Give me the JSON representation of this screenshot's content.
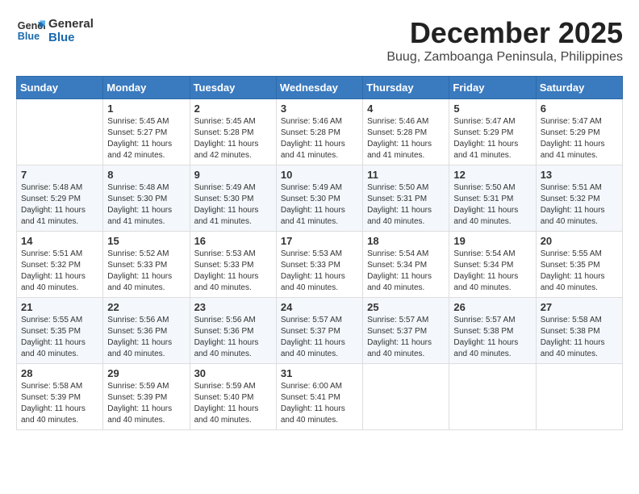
{
  "logo": {
    "line1": "General",
    "line2": "Blue"
  },
  "title": "December 2025",
  "location": "Buug, Zamboanga Peninsula, Philippines",
  "headers": [
    "Sunday",
    "Monday",
    "Tuesday",
    "Wednesday",
    "Thursday",
    "Friday",
    "Saturday"
  ],
  "weeks": [
    [
      {
        "day": "",
        "info": ""
      },
      {
        "day": "1",
        "info": "Sunrise: 5:45 AM\nSunset: 5:27 PM\nDaylight: 11 hours\nand 42 minutes."
      },
      {
        "day": "2",
        "info": "Sunrise: 5:45 AM\nSunset: 5:28 PM\nDaylight: 11 hours\nand 42 minutes."
      },
      {
        "day": "3",
        "info": "Sunrise: 5:46 AM\nSunset: 5:28 PM\nDaylight: 11 hours\nand 41 minutes."
      },
      {
        "day": "4",
        "info": "Sunrise: 5:46 AM\nSunset: 5:28 PM\nDaylight: 11 hours\nand 41 minutes."
      },
      {
        "day": "5",
        "info": "Sunrise: 5:47 AM\nSunset: 5:29 PM\nDaylight: 11 hours\nand 41 minutes."
      },
      {
        "day": "6",
        "info": "Sunrise: 5:47 AM\nSunset: 5:29 PM\nDaylight: 11 hours\nand 41 minutes."
      }
    ],
    [
      {
        "day": "7",
        "info": "Sunrise: 5:48 AM\nSunset: 5:29 PM\nDaylight: 11 hours\nand 41 minutes."
      },
      {
        "day": "8",
        "info": "Sunrise: 5:48 AM\nSunset: 5:30 PM\nDaylight: 11 hours\nand 41 minutes."
      },
      {
        "day": "9",
        "info": "Sunrise: 5:49 AM\nSunset: 5:30 PM\nDaylight: 11 hours\nand 41 minutes."
      },
      {
        "day": "10",
        "info": "Sunrise: 5:49 AM\nSunset: 5:30 PM\nDaylight: 11 hours\nand 41 minutes."
      },
      {
        "day": "11",
        "info": "Sunrise: 5:50 AM\nSunset: 5:31 PM\nDaylight: 11 hours\nand 40 minutes."
      },
      {
        "day": "12",
        "info": "Sunrise: 5:50 AM\nSunset: 5:31 PM\nDaylight: 11 hours\nand 40 minutes."
      },
      {
        "day": "13",
        "info": "Sunrise: 5:51 AM\nSunset: 5:32 PM\nDaylight: 11 hours\nand 40 minutes."
      }
    ],
    [
      {
        "day": "14",
        "info": "Sunrise: 5:51 AM\nSunset: 5:32 PM\nDaylight: 11 hours\nand 40 minutes."
      },
      {
        "day": "15",
        "info": "Sunrise: 5:52 AM\nSunset: 5:33 PM\nDaylight: 11 hours\nand 40 minutes."
      },
      {
        "day": "16",
        "info": "Sunrise: 5:53 AM\nSunset: 5:33 PM\nDaylight: 11 hours\nand 40 minutes."
      },
      {
        "day": "17",
        "info": "Sunrise: 5:53 AM\nSunset: 5:33 PM\nDaylight: 11 hours\nand 40 minutes."
      },
      {
        "day": "18",
        "info": "Sunrise: 5:54 AM\nSunset: 5:34 PM\nDaylight: 11 hours\nand 40 minutes."
      },
      {
        "day": "19",
        "info": "Sunrise: 5:54 AM\nSunset: 5:34 PM\nDaylight: 11 hours\nand 40 minutes."
      },
      {
        "day": "20",
        "info": "Sunrise: 5:55 AM\nSunset: 5:35 PM\nDaylight: 11 hours\nand 40 minutes."
      }
    ],
    [
      {
        "day": "21",
        "info": "Sunrise: 5:55 AM\nSunset: 5:35 PM\nDaylight: 11 hours\nand 40 minutes."
      },
      {
        "day": "22",
        "info": "Sunrise: 5:56 AM\nSunset: 5:36 PM\nDaylight: 11 hours\nand 40 minutes."
      },
      {
        "day": "23",
        "info": "Sunrise: 5:56 AM\nSunset: 5:36 PM\nDaylight: 11 hours\nand 40 minutes."
      },
      {
        "day": "24",
        "info": "Sunrise: 5:57 AM\nSunset: 5:37 PM\nDaylight: 11 hours\nand 40 minutes."
      },
      {
        "day": "25",
        "info": "Sunrise: 5:57 AM\nSunset: 5:37 PM\nDaylight: 11 hours\nand 40 minutes."
      },
      {
        "day": "26",
        "info": "Sunrise: 5:57 AM\nSunset: 5:38 PM\nDaylight: 11 hours\nand 40 minutes."
      },
      {
        "day": "27",
        "info": "Sunrise: 5:58 AM\nSunset: 5:38 PM\nDaylight: 11 hours\nand 40 minutes."
      }
    ],
    [
      {
        "day": "28",
        "info": "Sunrise: 5:58 AM\nSunset: 5:39 PM\nDaylight: 11 hours\nand 40 minutes."
      },
      {
        "day": "29",
        "info": "Sunrise: 5:59 AM\nSunset: 5:39 PM\nDaylight: 11 hours\nand 40 minutes."
      },
      {
        "day": "30",
        "info": "Sunrise: 5:59 AM\nSunset: 5:40 PM\nDaylight: 11 hours\nand 40 minutes."
      },
      {
        "day": "31",
        "info": "Sunrise: 6:00 AM\nSunset: 5:41 PM\nDaylight: 11 hours\nand 40 minutes."
      },
      {
        "day": "",
        "info": ""
      },
      {
        "day": "",
        "info": ""
      },
      {
        "day": "",
        "info": ""
      }
    ]
  ]
}
